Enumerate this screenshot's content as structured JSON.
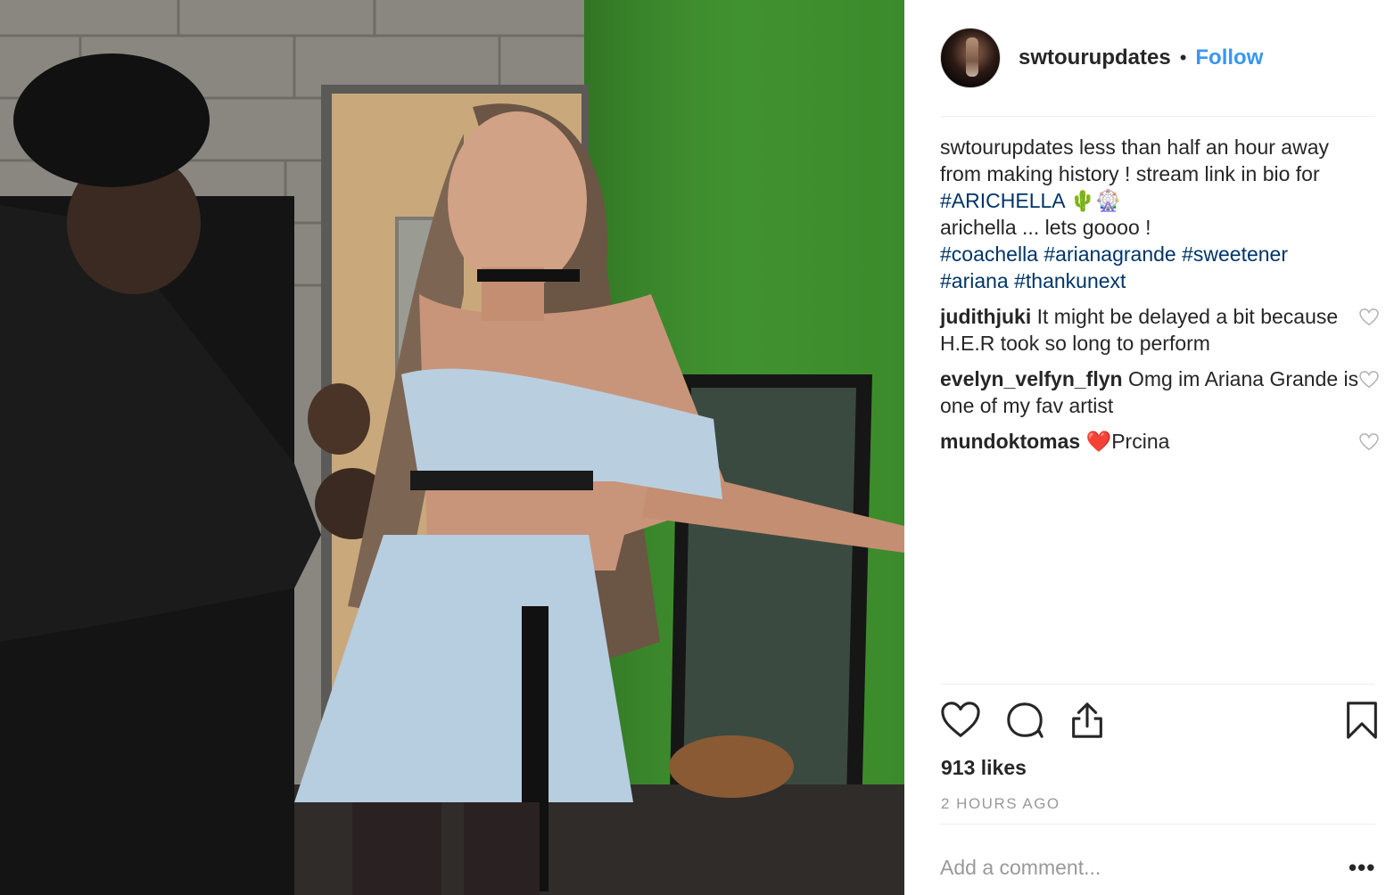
{
  "post": {
    "photo_alt": "",
    "author": {
      "username": "swtourupdates",
      "separator": "•",
      "follow_label": "Follow"
    },
    "caption": {
      "user": "swtourupdates",
      "line1": " less than half an hour away from making history ! stream link in bio for ",
      "hashtag_main": "#ARICHELLA",
      "emoji": " 🌵🎡",
      "line2": "arichella ... lets goooo !",
      "hashtags": [
        "#coachella",
        "#arianagrande",
        "#sweetener",
        "#ariana",
        "#thankunext"
      ]
    },
    "comments": [
      {
        "user": "judithjuki",
        "text": " It might be delayed a bit because H.E.R took so long to perform"
      },
      {
        "user": "evelyn_velfyn_flyn",
        "text": " Omg im Ariana Grande is one of my fav artist"
      },
      {
        "user": "mundoktomas",
        "text": " ❤️Prcina"
      }
    ],
    "likes_text": "913 likes",
    "time_text": "2 HOURS AGO",
    "add_comment_placeholder": "Add a comment...",
    "more_label": "•••",
    "icons": [
      "heart-icon",
      "comment-icon",
      "share-icon",
      "bookmark-icon",
      "heart-small-icon"
    ],
    "colors": {
      "follow": "#3897f0",
      "hashtag": "#003569",
      "muted": "#999999",
      "text": "#262626"
    }
  }
}
